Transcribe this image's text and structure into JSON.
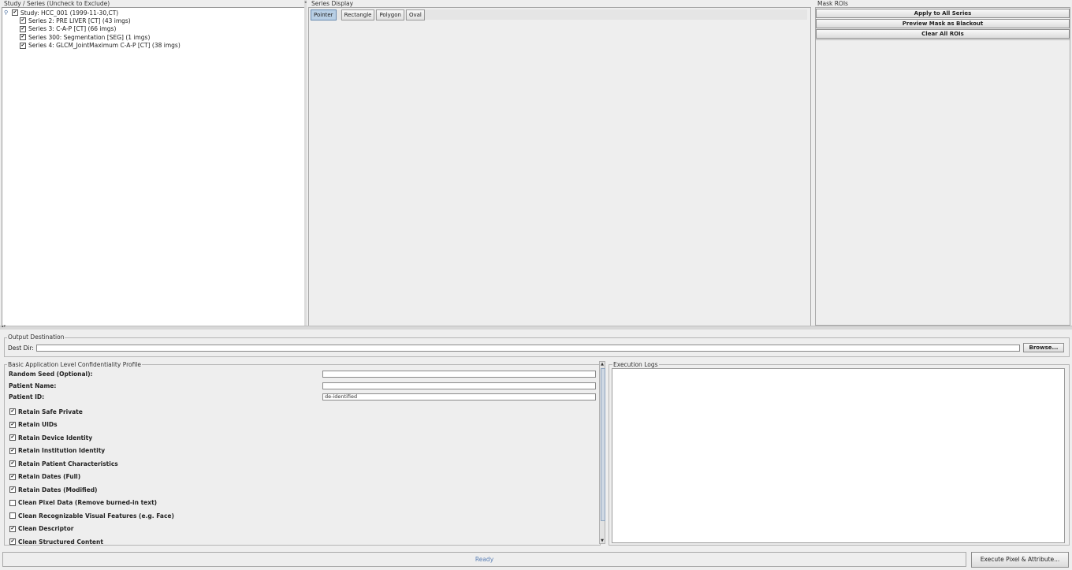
{
  "tree_panel": {
    "title": "Study / Series (Uncheck to Exclude)",
    "study": {
      "label": "Study: HCC_001 (1999-11-30,CT)",
      "checked": true
    },
    "series": [
      {
        "label": "Series 2: PRE LIVER [CT] (43 imgs)",
        "checked": true
      },
      {
        "label": "Series 3: C-A-P [CT] (66 imgs)",
        "checked": true
      },
      {
        "label": "Series 300: Segmentation [SEG] (1 imgs)",
        "checked": true
      },
      {
        "label": "Series 4: GLCM_JointMaximum C-A-P [CT] (38 imgs)",
        "checked": true
      }
    ]
  },
  "display_panel": {
    "title": "Series Display",
    "tools": [
      "Pointer",
      "Rectangle",
      "Polygon",
      "Oval"
    ],
    "selected_tool": "Pointer"
  },
  "mask_panel": {
    "title": "Mask ROIs",
    "buttons": [
      "Apply to All Series",
      "Preview Mask as Blackout",
      "Clear All ROIs"
    ]
  },
  "output": {
    "title": "Output Destination",
    "dest_label": "Dest Dir:",
    "dest_value": "",
    "browse_label": "Browse..."
  },
  "profile": {
    "title": "Basic Application Level Confidentiality Profile",
    "fields": [
      {
        "label": "Random Seed (Optional):",
        "value": ""
      },
      {
        "label": "Patient Name:",
        "value": ""
      },
      {
        "label": "Patient ID:",
        "value": "de-identified"
      }
    ],
    "options": [
      {
        "label": "Retain Safe Private",
        "checked": true
      },
      {
        "label": "Retain UIDs",
        "checked": true
      },
      {
        "label": "Retain Device Identity",
        "checked": true
      },
      {
        "label": "Retain Institution Identity",
        "checked": true
      },
      {
        "label": "Retain Patient Characteristics",
        "checked": true
      },
      {
        "label": "Retain Dates (Full)",
        "checked": true
      },
      {
        "label": "Retain Dates (Modified)",
        "checked": true
      },
      {
        "label": "Clean Pixel Data (Remove burned-in text)",
        "checked": false
      },
      {
        "label": "Clean Recognizable Visual Features (e.g. Face)",
        "checked": false
      },
      {
        "label": "Clean Descriptor",
        "checked": true
      },
      {
        "label": "Clean Structured Content",
        "checked": true
      }
    ]
  },
  "logs": {
    "title": "Execution Logs",
    "content": ""
  },
  "status": {
    "text": "Ready",
    "color": "#5a7fb5"
  },
  "execute_label": "Execute Pixel & Attribute..."
}
